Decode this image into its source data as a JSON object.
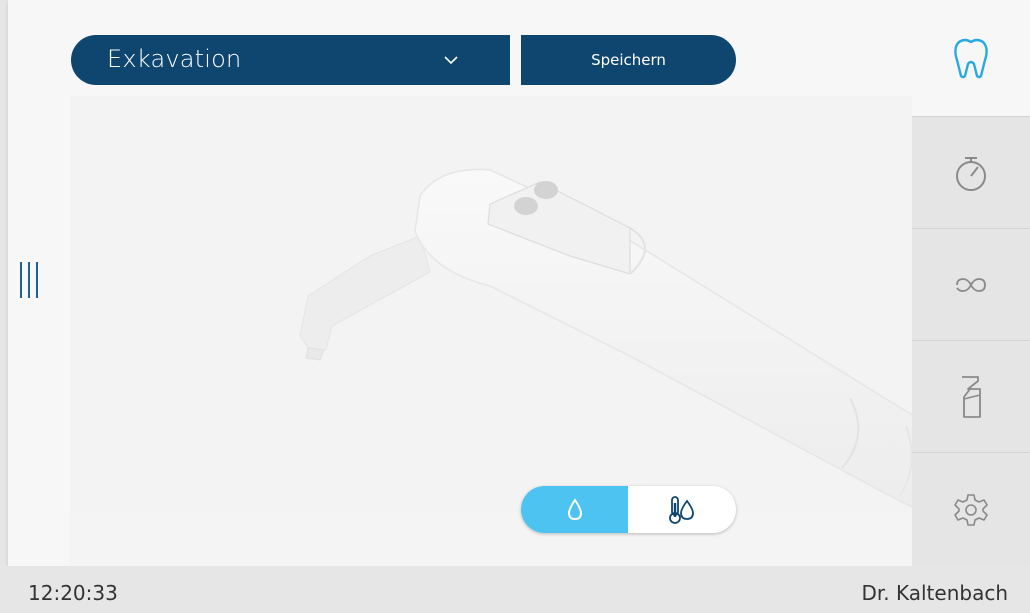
{
  "header": {
    "program_select": {
      "value": "Exkavation",
      "icon": "chevron-down-icon"
    },
    "save_label": "Speichern"
  },
  "side_nav": {
    "items": [
      {
        "name": "treatment",
        "icon": "tooth-icon",
        "active": true
      },
      {
        "name": "timer",
        "icon": "stopwatch-icon",
        "active": false
      },
      {
        "name": "loop",
        "icon": "infinity-loop-icon",
        "active": false
      },
      {
        "name": "spray",
        "icon": "spray-bottle-icon",
        "active": false
      },
      {
        "name": "settings",
        "icon": "gear-icon",
        "active": false
      }
    ]
  },
  "coolant_toggle": {
    "options": [
      {
        "name": "water",
        "icon": "water-drop-icon",
        "selected": true
      },
      {
        "name": "temperature",
        "icon": "thermometer-drop-icon",
        "selected": false
      }
    ]
  },
  "status_bar": {
    "time": "12:20:33",
    "user": "Dr. Kaltenbach"
  },
  "colors": {
    "primary": "#0e4670",
    "accent": "#4cc3f1",
    "icon_active": "#2aa8e0",
    "icon_inactive": "#8a8a8a"
  }
}
